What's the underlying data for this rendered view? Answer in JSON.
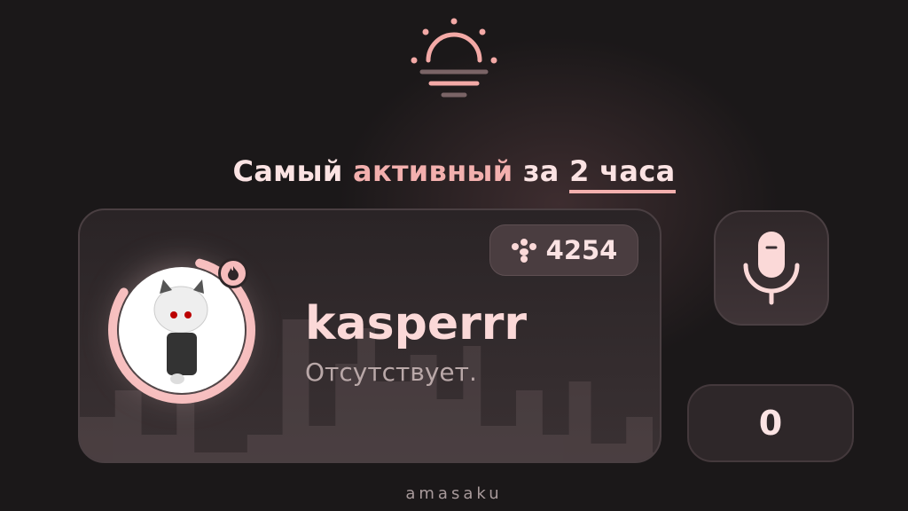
{
  "header": {
    "title_part1": "Самый",
    "title_accent": "активный",
    "title_part2": "за",
    "title_period": "2 часа"
  },
  "card": {
    "points": "4254",
    "username": "kasperrr",
    "status": "Отсутствует.",
    "progress_percent": 80
  },
  "voice": {
    "count": "0"
  },
  "footer": {
    "brand": "amasaku"
  },
  "colors": {
    "accent": "#f3b0ae",
    "background": "#1b1819"
  }
}
